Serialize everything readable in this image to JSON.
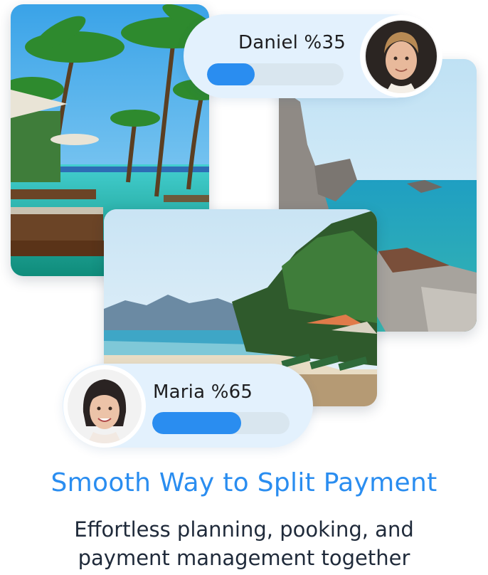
{
  "cards": [
    {
      "name": "Daniel",
      "percent_label": "%35",
      "progress": 0.35
    },
    {
      "name": "Maria",
      "percent_label": "%65",
      "progress": 0.65
    }
  ],
  "headline": "Smooth Way to Split Payment",
  "subline": {
    "line1": "Effortless planning, pooking, and",
    "line2": "payment management together"
  },
  "colors": {
    "accent": "#2a8df0",
    "card_background": "#e3f1fd",
    "track": "#d9e6ef",
    "body_text": "#1f2a3a"
  },
  "icons": {
    "daniel_avatar": "male-avatar-photo",
    "maria_avatar": "female-avatar-photo"
  }
}
